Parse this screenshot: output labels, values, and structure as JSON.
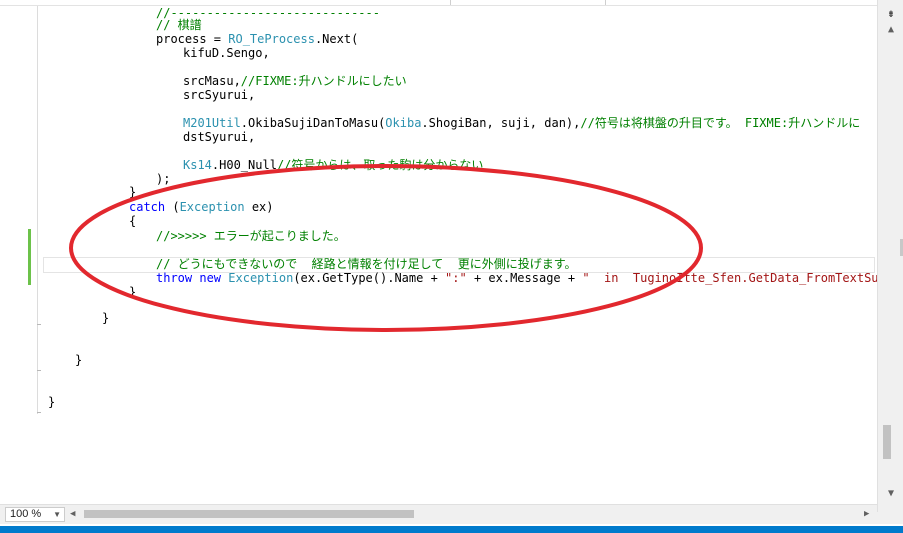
{
  "colors": {
    "keyword": "#0000ff",
    "type": "#2b91af",
    "comment": "#008000",
    "string": "#a31515",
    "plain": "#000000",
    "annotation_ellipse": "#e2282e",
    "status_bar": "#007acc",
    "change_indicator": "#6cc24a"
  },
  "code": {
    "lines": [
      [
        {
          "t": "cm",
          "v": "//-----------------------------"
        }
      ],
      [
        {
          "t": "cm",
          "v": "// 棋譜"
        }
      ],
      [
        {
          "t": "pl",
          "v": "process = "
        },
        {
          "t": "type",
          "v": "RO_TeProcess"
        },
        {
          "t": "pl",
          "v": ".Next("
        }
      ],
      [
        {
          "t": "pl",
          "v": "kifuD.Sengo,"
        }
      ],
      [],
      [
        {
          "t": "pl",
          "v": "srcMasu,"
        },
        {
          "t": "cm",
          "v": "//FIXME:升ハンドルにしたい"
        }
      ],
      [
        {
          "t": "pl",
          "v": "srcSyurui,"
        }
      ],
      [],
      [
        {
          "t": "type",
          "v": "M201Util"
        },
        {
          "t": "pl",
          "v": ".OkibaSujiDanToMasu("
        },
        {
          "t": "type",
          "v": "Okiba"
        },
        {
          "t": "pl",
          "v": ".ShogiBan, suji, dan),"
        },
        {
          "t": "cm",
          "v": "//符号は将棋盤の升目です。 FIXME:升ハンドルに"
        }
      ],
      [
        {
          "t": "pl",
          "v": "dstSyurui,"
        }
      ],
      [],
      [
        {
          "t": "type",
          "v": "Ks14"
        },
        {
          "t": "pl",
          "v": ".H00_Null"
        },
        {
          "t": "cm",
          "v": "//符号からは、取った駒は分からない"
        }
      ],
      [
        {
          "t": "pl",
          "v": ");"
        }
      ],
      [
        {
          "t": "pl",
          "v": "}"
        }
      ],
      [
        {
          "t": "kw",
          "v": "catch"
        },
        {
          "t": "pl",
          "v": " ("
        },
        {
          "t": "type",
          "v": "Exception"
        },
        {
          "t": "pl",
          "v": " ex)"
        }
      ],
      [
        {
          "t": "pl",
          "v": "{"
        }
      ],
      [
        {
          "t": "cm",
          "v": "//>>>>> エラーが起こりました。"
        }
      ],
      [],
      [
        {
          "t": "cm",
          "v": "// どうにもできないので  経路と情報を付け足して  更に外側に投げます。"
        }
      ],
      [
        {
          "t": "kw",
          "v": "throw"
        },
        {
          "t": "pl",
          "v": " "
        },
        {
          "t": "kw",
          "v": "new"
        },
        {
          "t": "pl",
          "v": " "
        },
        {
          "t": "type",
          "v": "Exception"
        },
        {
          "t": "pl",
          "v": "(ex.GetType().Name + "
        },
        {
          "t": "str",
          "v": "\":\""
        },
        {
          "t": "pl",
          "v": " + ex.Message + "
        },
        {
          "t": "str",
          "v": "\"  in  TuginoItte_Sfen.GetData_FromTextSub"
        }
      ],
      [
        {
          "t": "pl",
          "v": "}"
        }
      ],
      [],
      [
        {
          "t": "pl",
          "v": "}"
        }
      ],
      [],
      [],
      [
        {
          "t": "pl",
          "v": "}"
        }
      ],
      [],
      [],
      [
        {
          "t": "pl",
          "v": "}"
        }
      ]
    ]
  },
  "scrollbar": {
    "split_icon": "splitter-icon",
    "up_icon": "scroll-up-arrow-icon",
    "down_icon": "scroll-down-arrow-icon"
  },
  "status": {
    "zoom": "100 %",
    "zoom_dropdown_icon": "chevron-down-icon",
    "left_icon": "scroll-left-arrow-icon",
    "right_icon": "scroll-right-arrow-icon"
  },
  "annotation": {
    "shape": "ellipse",
    "description_icon": "red-ellipse-annotation"
  }
}
